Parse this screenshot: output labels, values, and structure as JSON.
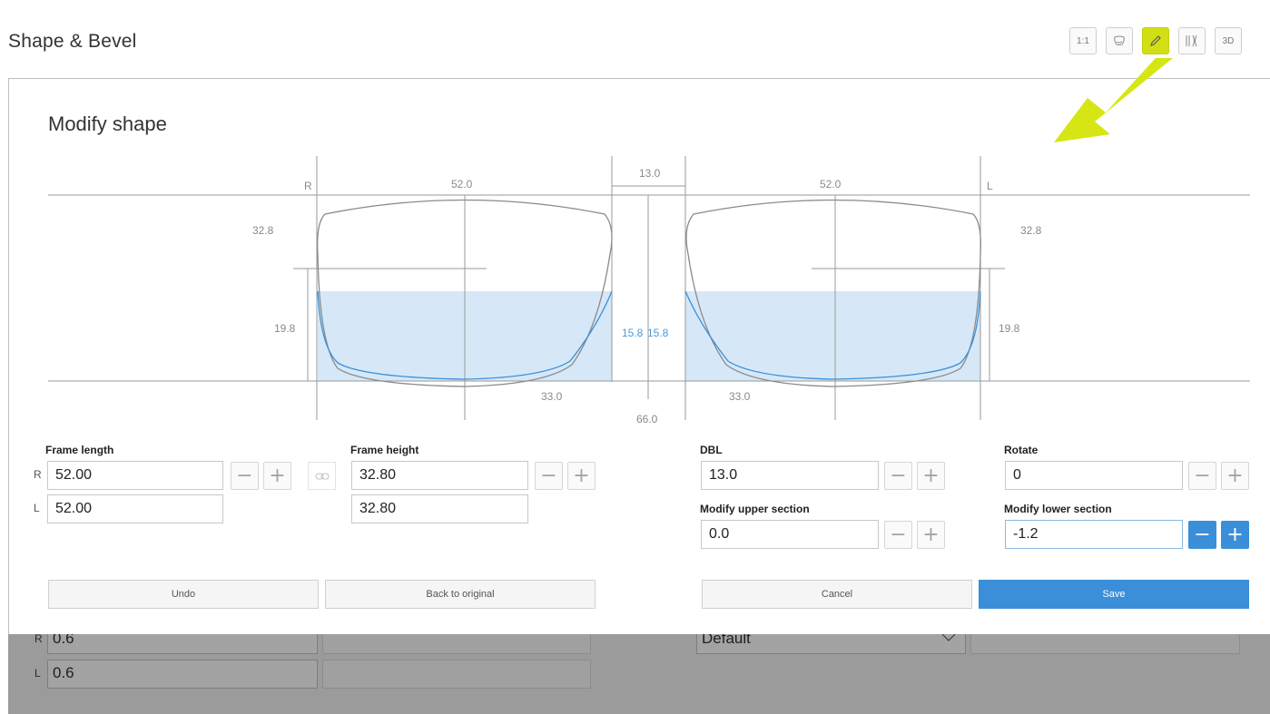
{
  "header": {
    "title": "Shape & Bevel",
    "toolbar": [
      {
        "id": "actual-size",
        "label": "1:1",
        "icon": "actual-size-icon"
      },
      {
        "id": "lens-shape",
        "label": "",
        "icon": "lens-shape-icon"
      },
      {
        "id": "edit",
        "label": "",
        "icon": "pencil-icon",
        "active": true
      },
      {
        "id": "bevel",
        "label": "",
        "icon": "bevel-profile-icon"
      },
      {
        "id": "view-3d",
        "label": "3D",
        "icon": "cube-3d-icon"
      }
    ]
  },
  "background": {
    "side_r": "R",
    "side_l": "L",
    "r_value": "0.6",
    "l_value": "0.6",
    "dropdown_value": "Default"
  },
  "modal": {
    "title": "Modify shape",
    "drawing": {
      "right_side": "R",
      "left_side": "L",
      "right_width": "52.0",
      "left_width": "52.0",
      "dbl": "13.0",
      "right_height": "32.8",
      "left_height": "32.8",
      "right_lower_height": "19.8",
      "left_lower_height": "19.8",
      "right_center_lower": "15.8",
      "left_center_lower": "15.8",
      "right_bottom_half": "33.0",
      "left_bottom_half": "33.0",
      "pd_total": "66.0"
    },
    "form": {
      "frame_length": {
        "label": "Frame length",
        "r": "52.00",
        "l": "52.00"
      },
      "frame_height": {
        "label": "Frame height",
        "r": "32.80",
        "l": "32.80"
      },
      "dbl": {
        "label": "DBL",
        "value": "13.0"
      },
      "rotate": {
        "label": "Rotate",
        "value": "0"
      },
      "upper": {
        "label": "Modify upper section",
        "value": "0.0"
      },
      "lower": {
        "label": "Modify lower section",
        "value": "-1.2"
      },
      "side_r": "R",
      "side_l": "L",
      "minus": "−",
      "plus": "+"
    },
    "buttons": {
      "undo": "Undo",
      "back": "Back to original",
      "cancel": "Cancel",
      "save": "Save"
    }
  },
  "colors": {
    "accent_yellow": "#d2df14",
    "primary_blue": "#3a8fd8",
    "fill_blue": "#d6e8f7"
  }
}
